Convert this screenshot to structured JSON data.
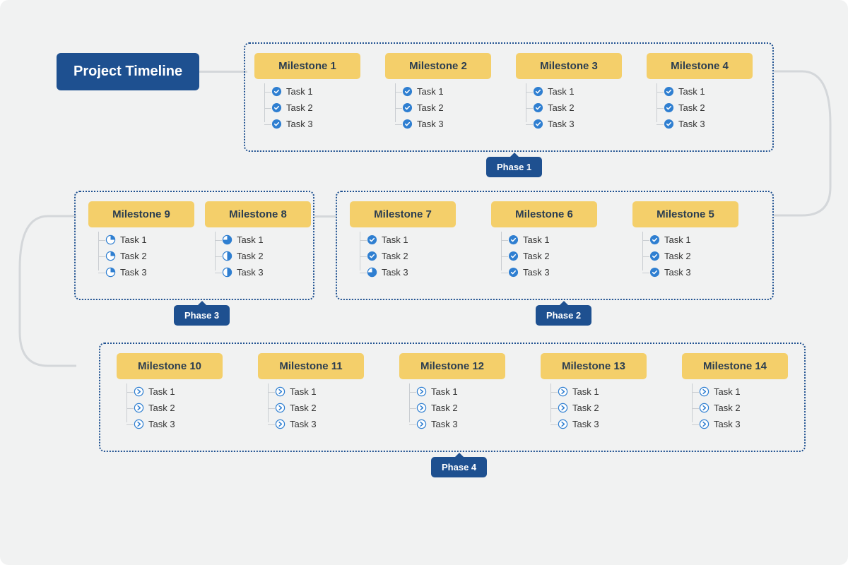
{
  "title": "Project Timeline",
  "phases": [
    {
      "id": 1,
      "label": "Phase 1"
    },
    {
      "id": 2,
      "label": "Phase 2"
    },
    {
      "id": 3,
      "label": "Phase 3"
    },
    {
      "id": 4,
      "label": "Phase 4"
    }
  ],
  "milestones": {
    "m1": {
      "label": "Milestone 1",
      "tasks": [
        {
          "label": "Task 1",
          "status": "done"
        },
        {
          "label": "Task 2",
          "status": "done"
        },
        {
          "label": "Task 3",
          "status": "done"
        }
      ]
    },
    "m2": {
      "label": "Milestone 2",
      "tasks": [
        {
          "label": "Task 1",
          "status": "done"
        },
        {
          "label": "Task 2",
          "status": "done"
        },
        {
          "label": "Task 3",
          "status": "done"
        }
      ]
    },
    "m3": {
      "label": "Milestone 3",
      "tasks": [
        {
          "label": "Task 1",
          "status": "done"
        },
        {
          "label": "Task 2",
          "status": "done"
        },
        {
          "label": "Task 3",
          "status": "done"
        }
      ]
    },
    "m4": {
      "label": "Milestone 4",
      "tasks": [
        {
          "label": "Task 1",
          "status": "done"
        },
        {
          "label": "Task 2",
          "status": "done"
        },
        {
          "label": "Task 3",
          "status": "done"
        }
      ]
    },
    "m5": {
      "label": "Milestone 5",
      "tasks": [
        {
          "label": "Task 1",
          "status": "done"
        },
        {
          "label": "Task 2",
          "status": "done"
        },
        {
          "label": "Task 3",
          "status": "done"
        }
      ]
    },
    "m6": {
      "label": "Milestone 6",
      "tasks": [
        {
          "label": "Task 1",
          "status": "done"
        },
        {
          "label": "Task 2",
          "status": "done"
        },
        {
          "label": "Task 3",
          "status": "done"
        }
      ]
    },
    "m7": {
      "label": "Milestone 7",
      "tasks": [
        {
          "label": "Task 1",
          "status": "done"
        },
        {
          "label": "Task 2",
          "status": "done"
        },
        {
          "label": "Task 3",
          "status": "mostly"
        }
      ]
    },
    "m8": {
      "label": "Milestone 8",
      "tasks": [
        {
          "label": "Task 1",
          "status": "mostly"
        },
        {
          "label": "Task 2",
          "status": "half"
        },
        {
          "label": "Task 3",
          "status": "half"
        }
      ]
    },
    "m9": {
      "label": "Milestone 9",
      "tasks": [
        {
          "label": "Task 1",
          "status": "quarter"
        },
        {
          "label": "Task 2",
          "status": "quarter"
        },
        {
          "label": "Task 3",
          "status": "quarter"
        }
      ]
    },
    "m10": {
      "label": "Milestone 10",
      "tasks": [
        {
          "label": "Task 1",
          "status": "pending"
        },
        {
          "label": "Task 2",
          "status": "pending"
        },
        {
          "label": "Task 3",
          "status": "pending"
        }
      ]
    },
    "m11": {
      "label": "Milestone 11",
      "tasks": [
        {
          "label": "Task 1",
          "status": "pending"
        },
        {
          "label": "Task 2",
          "status": "pending"
        },
        {
          "label": "Task 3",
          "status": "pending"
        }
      ]
    },
    "m12": {
      "label": "Milestone 12",
      "tasks": [
        {
          "label": "Task 1",
          "status": "pending"
        },
        {
          "label": "Task 2",
          "status": "pending"
        },
        {
          "label": "Task 3",
          "status": "pending"
        }
      ]
    },
    "m13": {
      "label": "Milestone 13",
      "tasks": [
        {
          "label": "Task 1",
          "status": "pending"
        },
        {
          "label": "Task 2",
          "status": "pending"
        },
        {
          "label": "Task 3",
          "status": "pending"
        }
      ]
    },
    "m14": {
      "label": "Milestone 14",
      "tasks": [
        {
          "label": "Task 1",
          "status": "pending"
        },
        {
          "label": "Task 2",
          "status": "pending"
        },
        {
          "label": "Task 3",
          "status": "pending"
        }
      ]
    }
  },
  "colors": {
    "primary": "#1e5090",
    "accent": "#f4cf6a",
    "icon_fill": "#2f7fd1",
    "icon_stroke": "#2f7fd1"
  }
}
